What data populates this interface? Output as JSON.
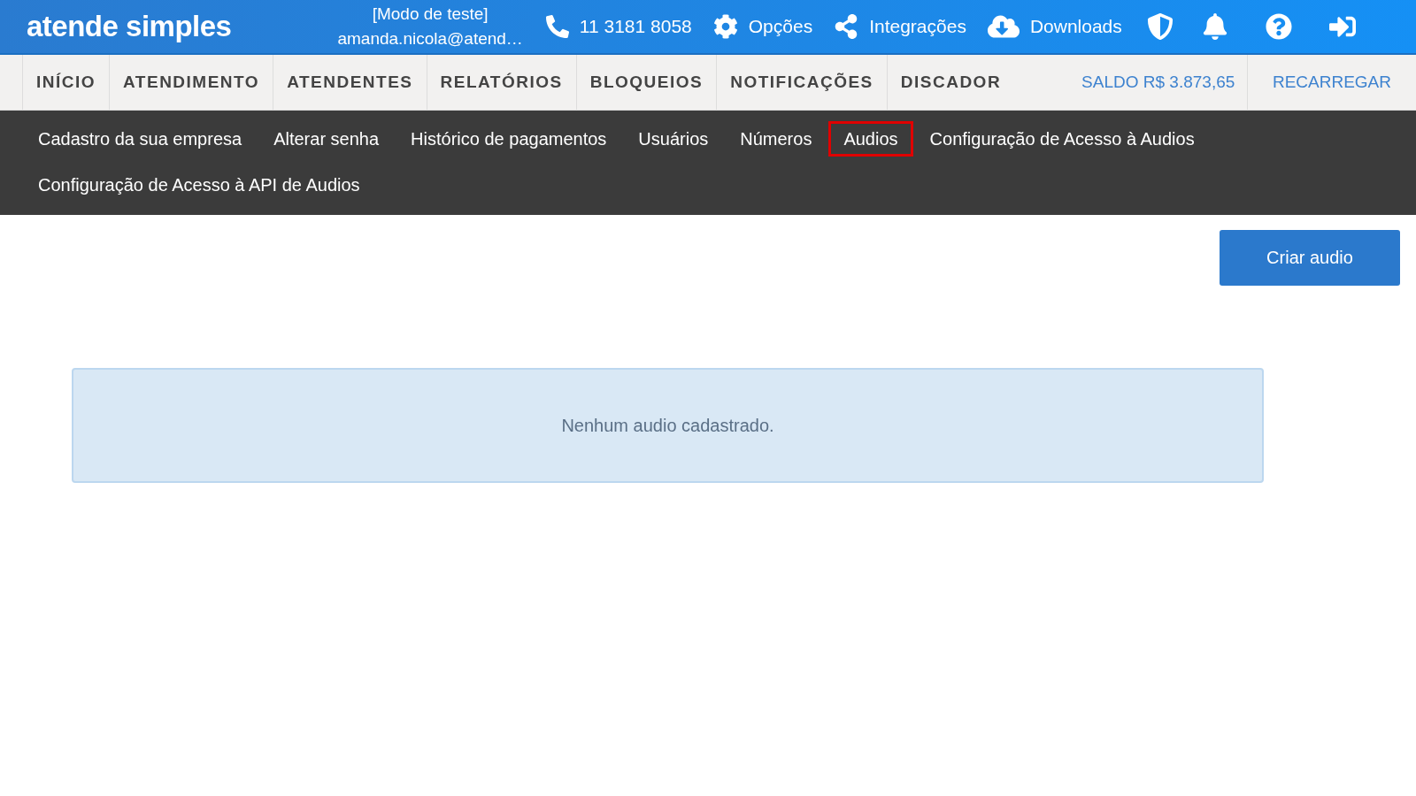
{
  "header": {
    "logo": "atende simples",
    "mode": "[Modo de teste]",
    "user": "amanda.nicola@atend…",
    "phone": "11 3181 8058",
    "links": [
      {
        "label": "Opções",
        "kind": "gear"
      },
      {
        "label": "Integrações",
        "kind": "share"
      },
      {
        "label": "Downloads",
        "kind": "cloud"
      }
    ]
  },
  "nav": {
    "items": [
      "INÍCIO",
      "ATENDIMENTO",
      "ATENDENTES",
      "RELATÓRIOS",
      "BLOQUEIOS",
      "NOTIFICAÇÕES",
      "DISCADOR"
    ],
    "balance": "SALDO R$ 3.873,65",
    "recharge": "RECARREGAR"
  },
  "subnav": [
    {
      "label": "Cadastro da sua empresa",
      "selected": false
    },
    {
      "label": "Alterar senha",
      "selected": false
    },
    {
      "label": "Histórico de pagamentos",
      "selected": false
    },
    {
      "label": "Usuários",
      "selected": false
    },
    {
      "label": "Números",
      "selected": false
    },
    {
      "label": "Audios",
      "selected": true
    },
    {
      "label": "Configuração de Acesso à Audios",
      "selected": false
    },
    {
      "label": "Configuração de Acesso à API de Audios",
      "selected": false
    }
  ],
  "create_button": "Criar audio",
  "empty_message": "Nenhum audio cadastrado."
}
